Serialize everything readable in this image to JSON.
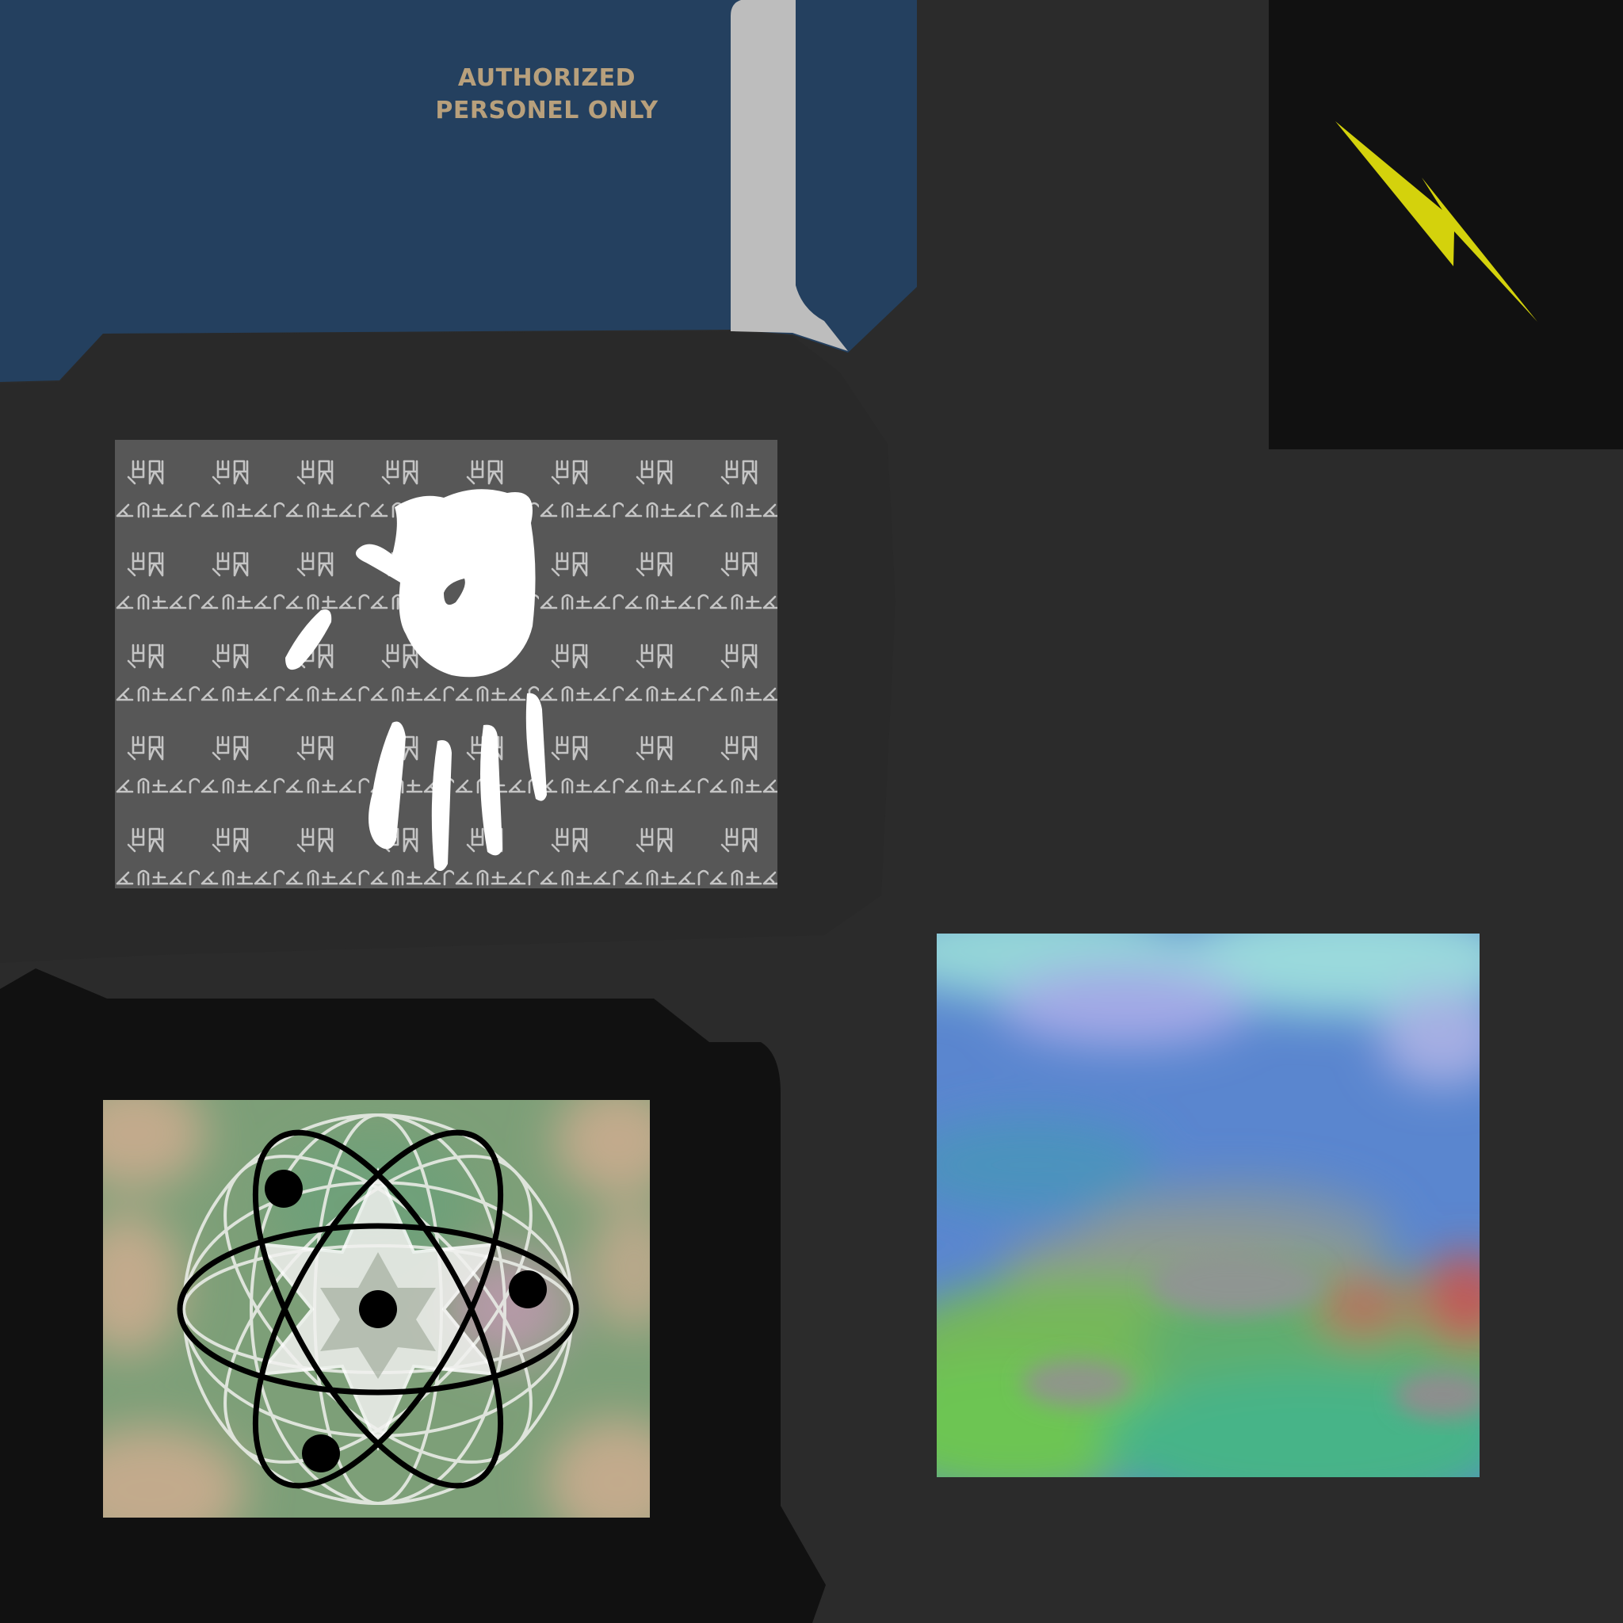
{
  "sign": {
    "line1": "AUTHORIZED",
    "line2": "PERSONEL ONLY"
  },
  "colors": {
    "background": "#2b2b2b",
    "dark_panel": "#111111",
    "navy_panel": "#24405f",
    "grey_strip": "#bdbdbd",
    "sign_text": "#b8a07c",
    "lightning": "#d4d20c",
    "glyph_panel": "#575757",
    "glyph_stroke": "#bdbdbd",
    "handprint": "#ffffff"
  },
  "icons": {
    "lightning": "lightning-bolt-icon",
    "handprint": "handprint-icon",
    "atom": "atom-icon"
  },
  "glyph_rows": {
    "a": "뵞 뵞 뵞 뵞",
    "b": "ㄥ ㄇ ㄴ"
  }
}
